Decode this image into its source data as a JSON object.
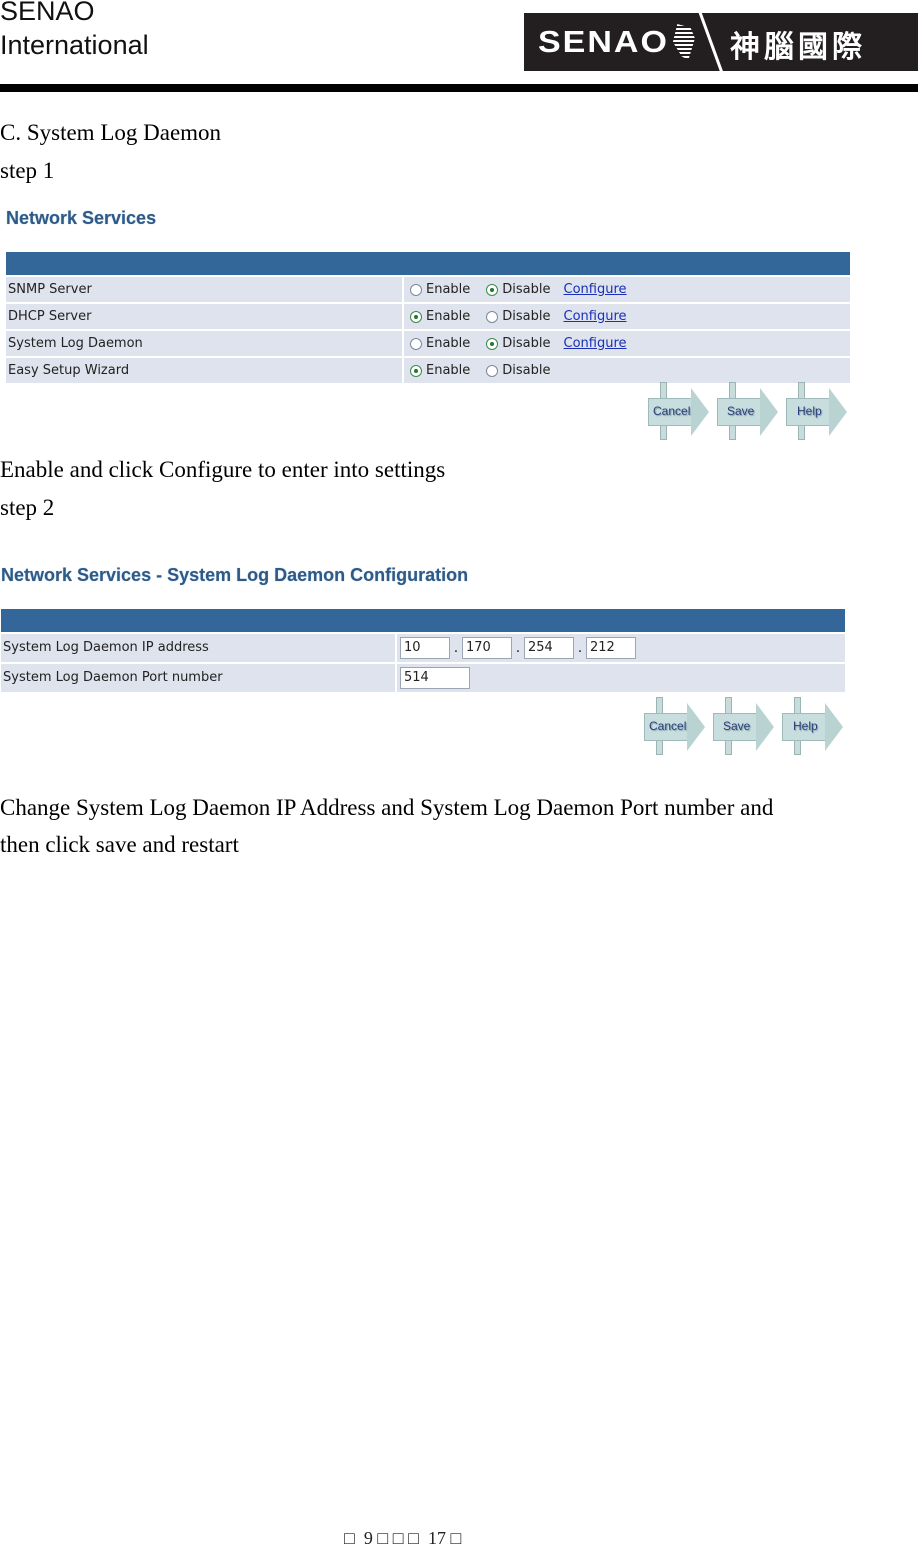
{
  "header": {
    "company_line1": "SENAO",
    "company_line2": "International",
    "logo_en": "SENAO",
    "logo_zh": "神腦國際"
  },
  "section_title": "C. System Log Daemon",
  "step1": {
    "label": "step 1",
    "panel_title": "Network Services",
    "rows": [
      {
        "label": "SNMP Server",
        "enable": "Enable",
        "disable": "Disable",
        "selected": "Disable",
        "configure": "Configure"
      },
      {
        "label": "DHCP Server",
        "enable": "Enable",
        "disable": "Disable",
        "selected": "Enable",
        "configure": "Configure"
      },
      {
        "label": "System Log Daemon",
        "enable": "Enable",
        "disable": "Disable",
        "selected": "Disable",
        "configure": "Configure"
      },
      {
        "label": "Easy Setup Wizard",
        "enable": "Enable",
        "disable": "Disable",
        "selected": "Enable",
        "configure": ""
      }
    ],
    "buttons": {
      "cancel": "Cancel",
      "save": "Save",
      "help": "Help"
    },
    "instruction": "Enable and click Configure to enter into settings"
  },
  "step2": {
    "label": "step 2",
    "panel_title": "Network Services - System Log Daemon Configuration",
    "ip_label": "System Log Daemon IP address",
    "ip_octets": [
      "10",
      "170",
      "254",
      "212"
    ],
    "ip_separator": ".",
    "port_label": "System Log Daemon Port number",
    "port_value": "514",
    "buttons": {
      "cancel": "Cancel",
      "save": "Save",
      "help": "Help"
    },
    "instruction_line1": "Change System Log Daemon IP Address and System Log Daemon Port number and",
    "instruction_line2": "then click save and restart"
  },
  "footer": {
    "text": "□  9 □ □ □  17 □",
    "page": "9",
    "total_pages": "17"
  }
}
